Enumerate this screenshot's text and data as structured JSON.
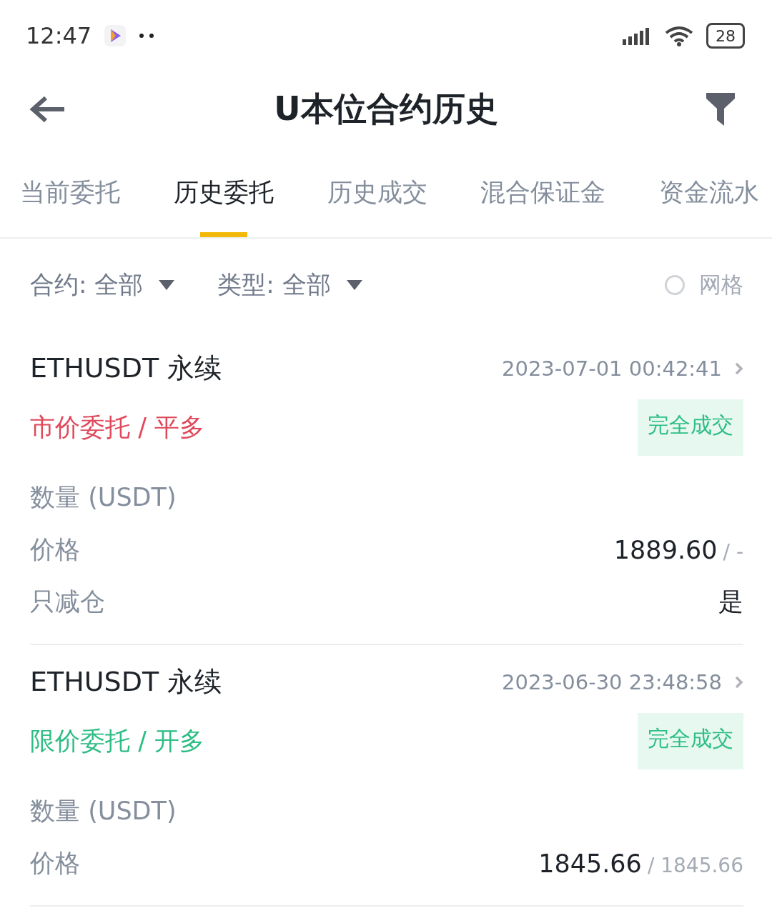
{
  "status_bar": {
    "time": "12:47",
    "battery": "28"
  },
  "header": {
    "title": "U本位合约历史"
  },
  "tabs": [
    {
      "label": "当前委托",
      "selected": false
    },
    {
      "label": "历史委托",
      "selected": true
    },
    {
      "label": "历史成交",
      "selected": false
    },
    {
      "label": "混合保证金",
      "selected": false
    },
    {
      "label": "资金流水",
      "selected": false
    }
  ],
  "filters": [
    {
      "label": "合约: 全部"
    },
    {
      "label": "类型: 全部"
    }
  ],
  "grid_toggle": {
    "label": "网格",
    "checked": false
  },
  "orders": [
    {
      "symbol": "ETHUSDT 永续",
      "time": "2023-07-01 00:42:41",
      "kind": "sell",
      "type": "市价委托 / 平多",
      "status": "完全成交",
      "fields": [
        {
          "label": "数量 (USDT)"
        },
        {
          "label": "价格",
          "value": "1889.60",
          "secondary": "/ -"
        },
        {
          "label": "只减仓",
          "value": "是"
        }
      ]
    },
    {
      "symbol": "ETHUSDT 永续",
      "time": "2023-06-30 23:48:58",
      "kind": "buy",
      "type": "限价委托 / 开多",
      "status": "完全成交",
      "fields": [
        {
          "label": "数量 (USDT)"
        },
        {
          "label": "价格",
          "value": "1845.66",
          "secondary": "/ 1845.66"
        }
      ]
    }
  ]
}
